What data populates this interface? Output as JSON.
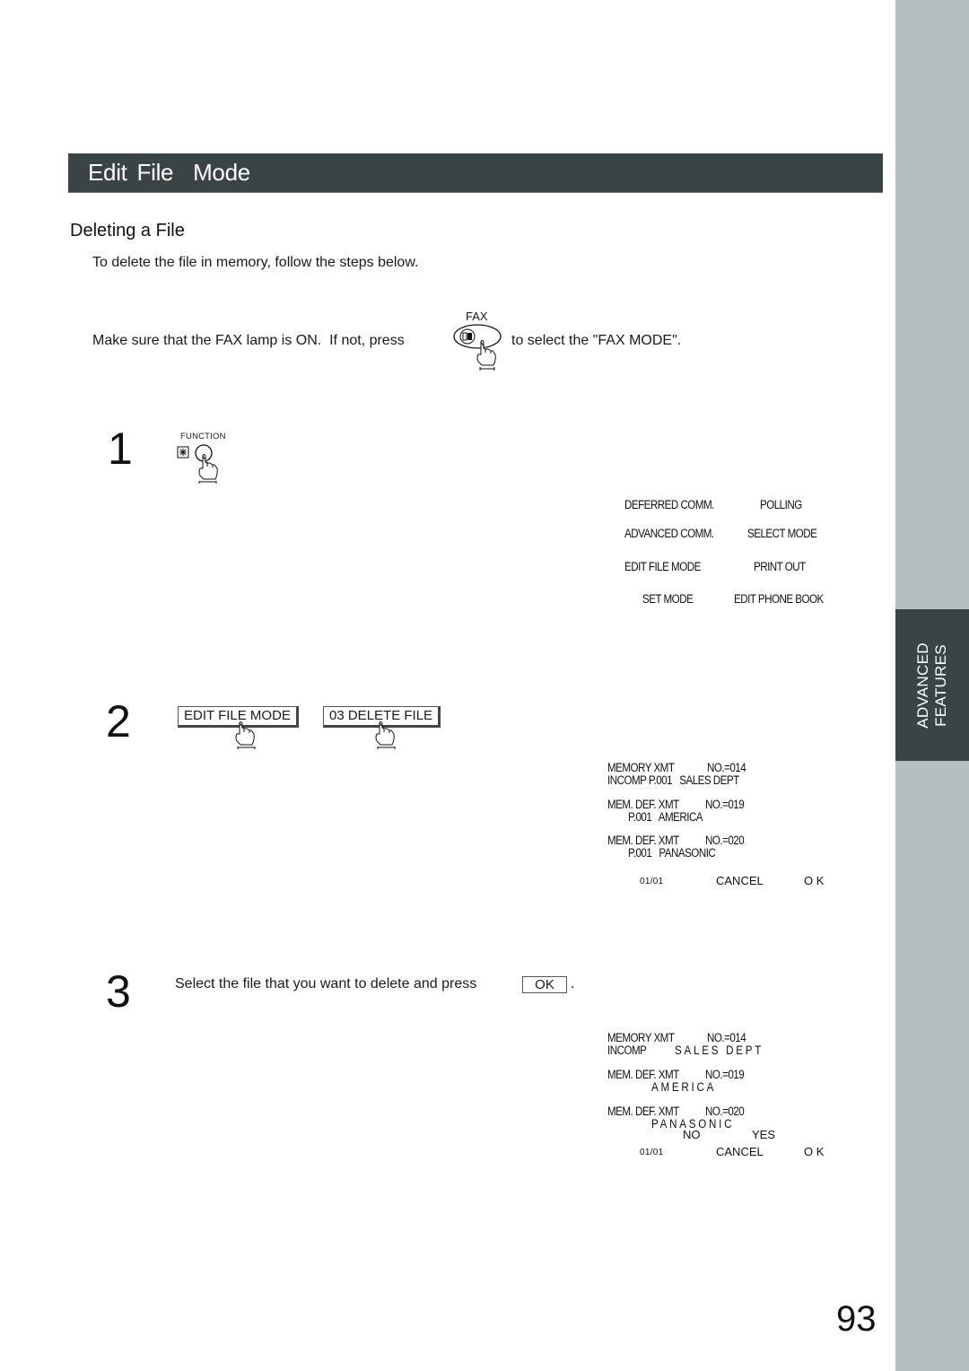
{
  "side_tab": {
    "line1": "ADVANCED",
    "line2": "FEATURES"
  },
  "header": {
    "title": "Edit File  Mode"
  },
  "section_title": "Deleting a File",
  "intro": "To delete the file in memory, follow the steps below.",
  "fax_instruction": {
    "before": "Make sure that the FAX lamp is ON.  If not, press",
    "key_label": "FAX",
    "after": "to select the \"FAX MODE\"."
  },
  "steps": [
    {
      "number": "1",
      "key_label": "FUNCTION",
      "menu_items": [
        "DEFERRED COMM.",
        "POLLING",
        "ADVANCED COMM.",
        "SELECT MODE",
        "EDIT FILE MODE",
        "PRINT OUT",
        "SET MODE",
        "EDIT PHONE BOOK"
      ]
    },
    {
      "number": "2",
      "keys": [
        "EDIT FILE MODE",
        "03 DELETE FILE"
      ],
      "display": {
        "files": [
          {
            "type": "MEMORY XMT",
            "no": "NO.=014",
            "line2": "INCOMP P.001   SALES DEPT"
          },
          {
            "type": "MEM. DEF. XMT",
            "no": "NO.=019",
            "line2": "P.001   AMERICA"
          },
          {
            "type": "MEM. DEF. XMT",
            "no": "NO.=020",
            "line2": "P.001   PANASONIC"
          }
        ],
        "page": "01/01",
        "cancel": "CANCEL",
        "ok": "O K"
      }
    },
    {
      "number": "3",
      "text": "Select the file that you want to delete and press",
      "ok_key": "OK",
      "period": ".",
      "display": {
        "files": [
          {
            "type": "MEMORY XMT",
            "no": "NO.=014",
            "line2a": "INCOMP",
            "line2b": "SALES DEPT"
          },
          {
            "type": "MEM. DEF. XMT",
            "no": "NO.=019",
            "line2b": "AMERICA"
          },
          {
            "type": "MEM. DEF. XMT",
            "no": "NO.=020",
            "line2b": "PANASONIC"
          }
        ],
        "no_label": "NO",
        "yes_label": "YES",
        "page": "01/01",
        "cancel": "CANCEL",
        "ok": "O K"
      }
    }
  ],
  "page_number": "93"
}
